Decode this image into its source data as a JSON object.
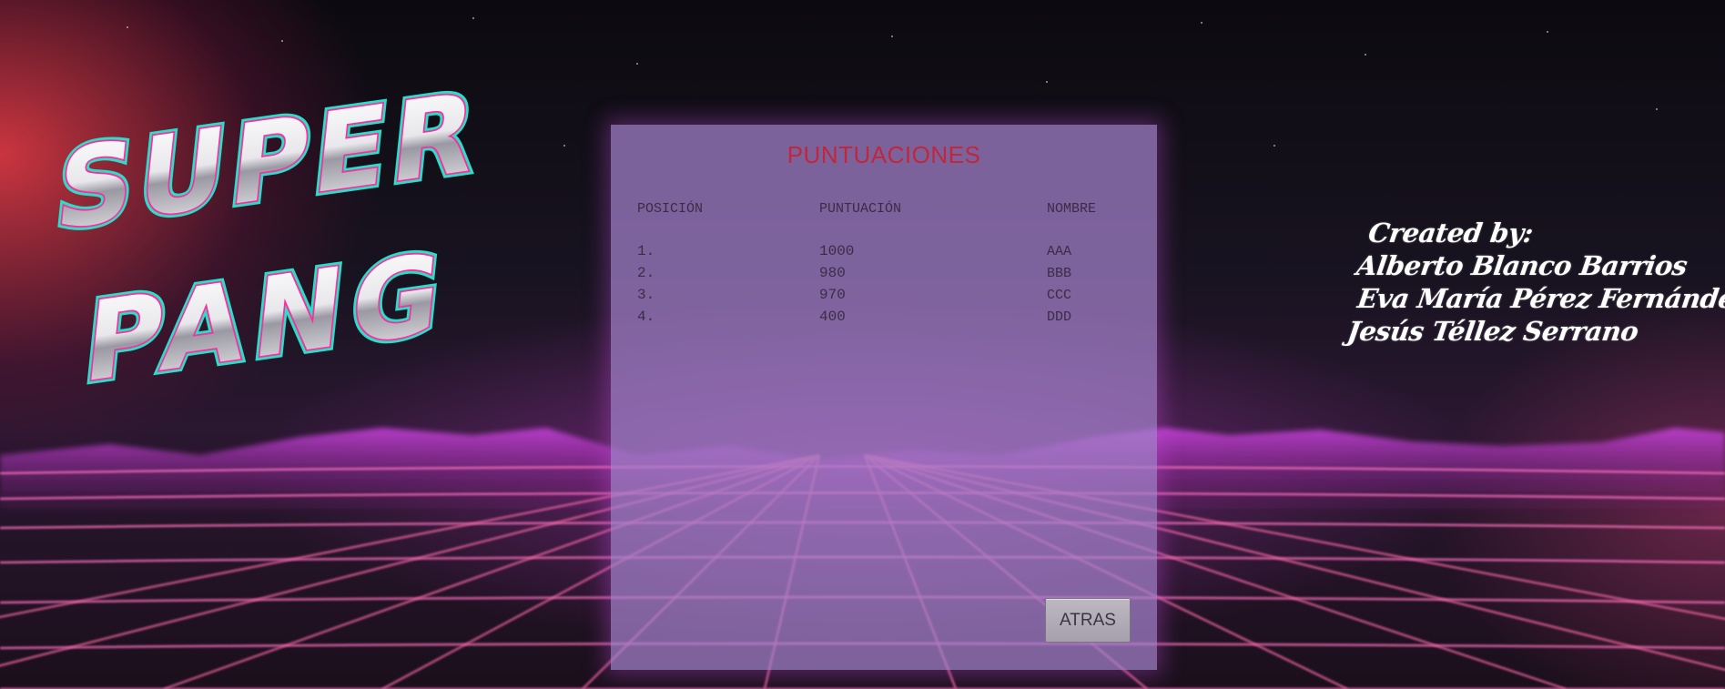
{
  "game": {
    "title_line1": "SUPER",
    "title_line2": "PANG"
  },
  "credits": {
    "heading": "Created by:",
    "authors": [
      "Alberto Blanco Barrios",
      "Eva María Pérez Fernández",
      "Jesús Téllez Serrano"
    ]
  },
  "scores": {
    "title": "PUNTUACIONES",
    "columns": [
      "POSICIÓN",
      "PUNTUACIÓN",
      "NOMBRE"
    ],
    "rows": [
      {
        "position": "1.",
        "score": "1000",
        "name": "AAA"
      },
      {
        "position": "2.",
        "score": "980",
        "name": "BBB"
      },
      {
        "position": "3.",
        "score": "970",
        "name": "CCC"
      },
      {
        "position": "4.",
        "score": "400",
        "name": "DDD"
      }
    ],
    "back_label": "ATRAS"
  },
  "colors": {
    "title_red": "#c2263c",
    "panel": "#a582cd",
    "grid_pink": "#f06ab4",
    "logo_cyan": "#27e0c8",
    "logo_magenta": "#ff2c9c"
  }
}
